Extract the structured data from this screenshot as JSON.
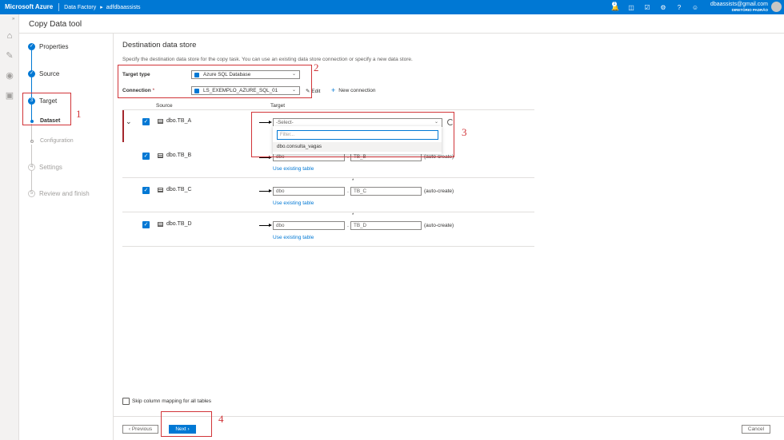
{
  "topbar": {
    "brand": "Microsoft Azure",
    "crumb1": "Data Factory",
    "crumb_sep": "▸",
    "crumb2": "adfdbaassists",
    "badge": "1",
    "user_email": "dbaassists@gmail.com",
    "user_directory": "DIRETÓRIO PADRÃO",
    "icons": [
      "notifications-icon",
      "directory-filter-icon",
      "cloud-shell-icon",
      "settings-icon",
      "help-icon",
      "feedback-icon"
    ]
  },
  "rail": {
    "expand": "»",
    "items": [
      "home-icon",
      "author-icon",
      "monitor-icon",
      "manage-icon"
    ]
  },
  "app_title": "Copy Data tool",
  "steps": {
    "properties": "Properties",
    "source": "Source",
    "target": "Target",
    "target_num": "3",
    "dataset": "Dataset",
    "configuration": "Configuration",
    "settings": "Settings",
    "settings_num": "4",
    "review": "Review and finish",
    "review_num": "5"
  },
  "main": {
    "heading": "Destination data store",
    "description": "Specify the destination data store for the copy task. You can use an existing data store connection or specify a new data store.",
    "target_type_label": "Target type",
    "target_type_value": "Azure SQL Database",
    "connection_label": "Connection",
    "connection_required": "*",
    "connection_value": "LS_EXEMPLO_AZURE_SQL_01",
    "edit_label": "Edit",
    "new_connection_label": "New connection",
    "col_source": "Source",
    "col_target": "Target",
    "rows": [
      {
        "source": "dbo.TB_A",
        "select_placeholder": "-Select-"
      },
      {
        "source": "dbo.TB_B",
        "schema": "dbo",
        "table": "TB_B",
        "auto": "(auto-create)",
        "link": "Use existing table"
      },
      {
        "source": "dbo.TB_C",
        "schema": "dbo",
        "table": "TB_C",
        "auto": "(auto-create)",
        "link": "Use existing table",
        "star": "*"
      },
      {
        "source": "dbo.TB_D",
        "schema": "dbo",
        "table": "TB_D",
        "auto": "(auto-create)",
        "link": "Use existing table",
        "star": "*"
      }
    ],
    "popup": {
      "filter_placeholder": "Filter...",
      "option": "dbo.consulta_vagas"
    },
    "skip_label": "Skip column mapping for all tables",
    "previous_label": "‹ Previous",
    "next_label": "Next ›",
    "cancel_label": "Cancel"
  },
  "annotations": [
    "1",
    "2",
    "3",
    "4"
  ],
  "colors": {
    "azure_blue": "#0078d4",
    "annotation_red": "#d13438"
  }
}
